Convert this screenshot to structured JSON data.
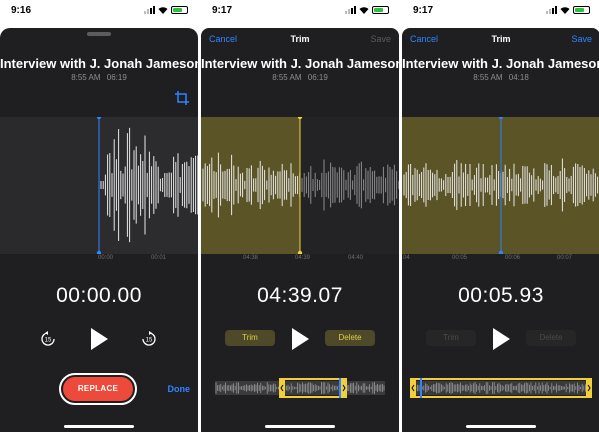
{
  "screens": [
    {
      "status": {
        "time": "9:16"
      },
      "title": "Interview with J. Jonah Jameson",
      "meta": {
        "time_of_day": "8:55 AM",
        "duration": "06:19"
      },
      "ticks": [
        "00:00",
        "00:01"
      ],
      "timer": "00:00.00",
      "replace_label": "REPLACE",
      "done_label": "Done",
      "icons": {
        "crop": "crop-icon",
        "skip_back": "skip-back-15-icon",
        "play": "play-icon",
        "skip_forward": "skip-forward-15-icon"
      }
    },
    {
      "status": {
        "time": "9:17"
      },
      "nav": {
        "cancel": "Cancel",
        "title": "Trim",
        "save": "Save",
        "save_enabled": false
      },
      "title": "Interview with J. Jonah Jameson",
      "meta": {
        "time_of_day": "8:55 AM",
        "duration": "06:19"
      },
      "ticks": [
        "04:38",
        "04:39",
        "04:40"
      ],
      "timer": "04:39.07",
      "trim_label": "Trim",
      "delete_label": "Delete",
      "buttons_enabled": true
    },
    {
      "status": {
        "time": "9:17"
      },
      "nav": {
        "cancel": "Cancel",
        "title": "Trim",
        "save": "Save",
        "save_enabled": true
      },
      "title": "Interview with J. Jonah Jameson",
      "meta": {
        "time_of_day": "8:55 AM",
        "duration": "04:18"
      },
      "ticks": [
        "04",
        "00:05",
        "00:06",
        "00:07"
      ],
      "timer": "00:05.93",
      "trim_label": "Trim",
      "delete_label": "Delete",
      "buttons_enabled": false
    }
  ],
  "colors": {
    "background": "#1f1f21",
    "accent_blue": "#2f84ff",
    "trim_highlight": "#5a5427",
    "trim_handle": "#f1cf3a",
    "record_red": "#ed4a3c"
  }
}
